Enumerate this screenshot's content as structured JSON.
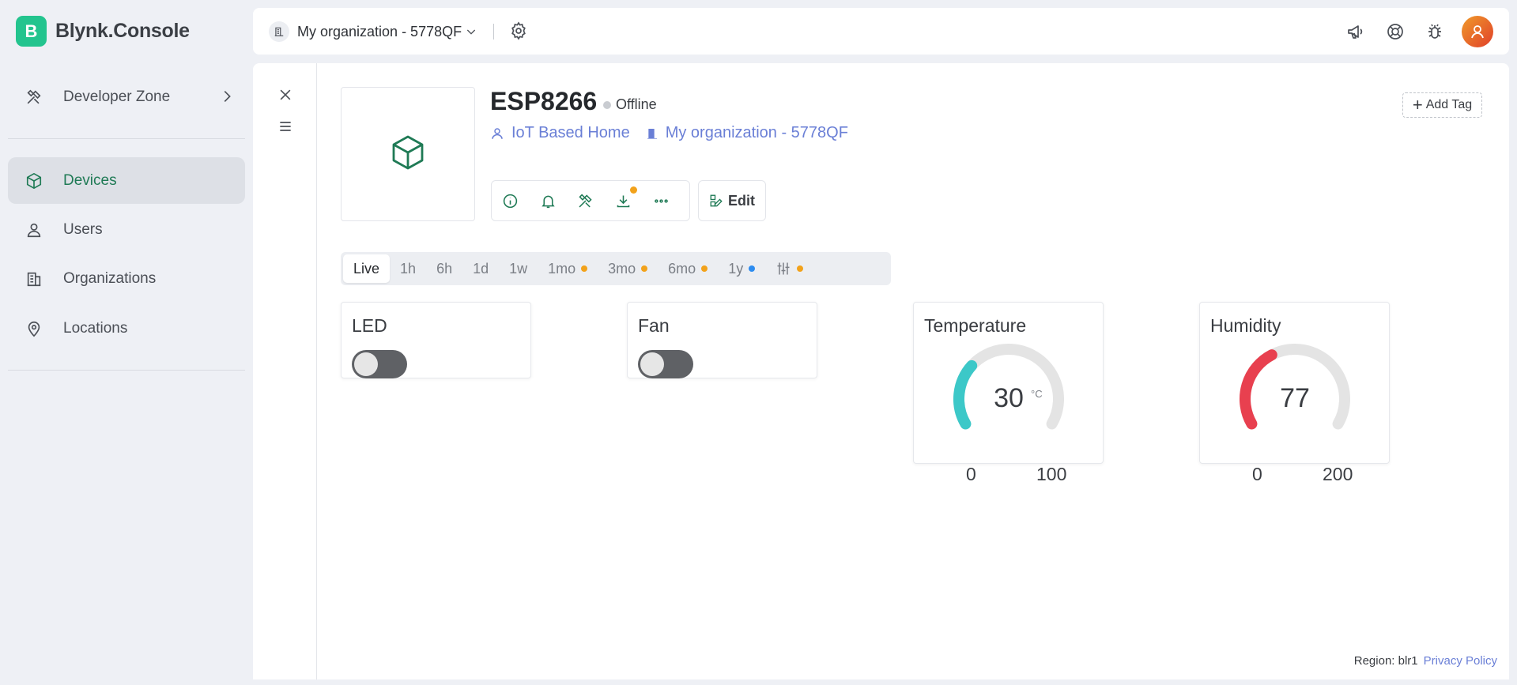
{
  "brand": {
    "logo_letter": "B",
    "name": "Blynk.Console",
    "color": "#23c48e"
  },
  "sidebar": {
    "items": [
      {
        "label": "Developer Zone",
        "icon": "tools-icon"
      },
      {
        "label": "Devices",
        "icon": "cube-icon",
        "active": true
      },
      {
        "label": "Users",
        "icon": "users-icon"
      },
      {
        "label": "Organizations",
        "icon": "building-icon"
      },
      {
        "label": "Locations",
        "icon": "location-pin-icon"
      }
    ]
  },
  "header": {
    "org_name": "My organization - 5778QF",
    "icons": [
      "megaphone-icon",
      "support-icon",
      "bug-icon",
      "avatar"
    ]
  },
  "device": {
    "name": "ESP8266",
    "status": "Offline",
    "template_link": "IoT Based Home",
    "org_link": "My organization - 5778QF",
    "edit_label": "Edit",
    "add_tag_label": "Add Tag"
  },
  "time_ranges": [
    {
      "label": "Live",
      "active": true
    },
    {
      "label": "1h"
    },
    {
      "label": "6h"
    },
    {
      "label": "1d"
    },
    {
      "label": "1w"
    },
    {
      "label": "1mo",
      "dot": "#f2a21b"
    },
    {
      "label": "3mo",
      "dot": "#f2a21b"
    },
    {
      "label": "6mo",
      "dot": "#f2a21b"
    },
    {
      "label": "1y",
      "dot": "#2d8cf0"
    },
    {
      "label": "",
      "icon": "sliders-icon",
      "dot": "#f2a21b"
    }
  ],
  "widgets": {
    "led": {
      "title": "LED",
      "on": false
    },
    "fan": {
      "title": "Fan",
      "on": false
    },
    "temperature": {
      "title": "Temperature",
      "value": "30",
      "unit": "°C",
      "min": "0",
      "max": "100",
      "color": "#3cc8c8",
      "value_num": 30,
      "min_num": 0,
      "max_num": 100
    },
    "humidity": {
      "title": "Humidity",
      "value": "77",
      "unit": "",
      "min": "0",
      "max": "200",
      "color": "#e8404f",
      "value_num": 77,
      "min_num": 0,
      "max_num": 200
    }
  },
  "footer": {
    "region": "Region: blr1",
    "privacy": "Privacy Policy"
  },
  "colors": {
    "accent": "#1f7a55",
    "link": "#6a7fd6",
    "background": "#eef0f5"
  }
}
